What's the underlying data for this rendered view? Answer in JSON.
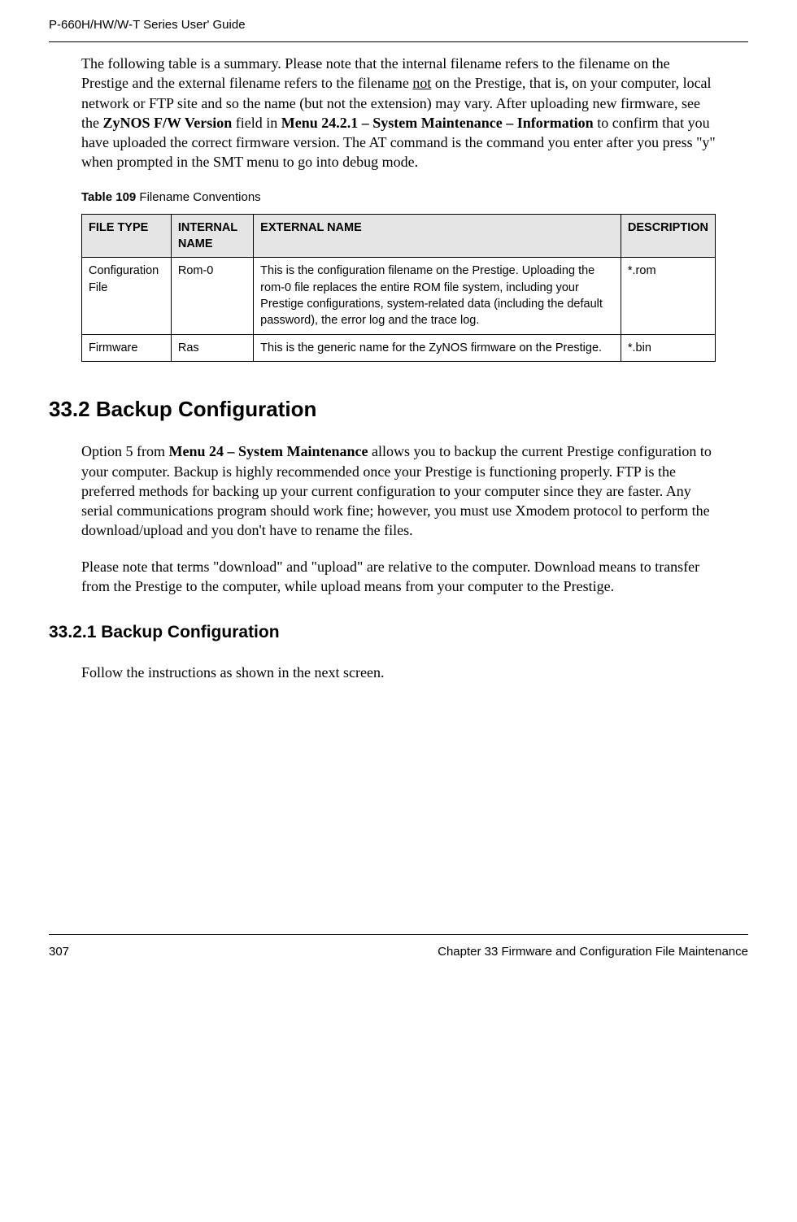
{
  "header": {
    "guide_title": "P-660H/HW/W-T Series User' Guide"
  },
  "intro": {
    "text_before_underline": "The following table is a summary. Please note that the internal filename refers to the filename on the Prestige and the external filename refers to the filename ",
    "underlined": "not",
    "text_after_underline": " on the Prestige, that is, on your computer, local network or FTP site and so the name (but not the extension) may vary. After uploading new firmware, see the ",
    "bold1": "ZyNOS F/W Version",
    "mid1": " field in ",
    "bold2": "Menu 24.2.1 – System Maintenance – Information",
    "tail": " to confirm that you have uploaded the correct firmware version. The AT command is the command you enter after you press \"y\" when prompted in the SMT menu to go into debug mode."
  },
  "table": {
    "caption_label": "Table 109",
    "caption_text": "   Filename Conventions",
    "headers": {
      "col1": "FILE TYPE",
      "col2": "INTERNAL NAME",
      "col3": "EXTERNAL NAME",
      "col4": "DESCRIPTION"
    },
    "rows": [
      {
        "file_type": "Configuration File",
        "internal_name": "Rom-0",
        "external_name": "This is the configuration filename on the Prestige. Uploading the rom-0 file replaces the entire ROM file system, including your Prestige configurations, system-related data (including the default password), the error log and the trace log.",
        "description": "*.rom"
      },
      {
        "file_type": "Firmware",
        "internal_name": "Ras",
        "external_name": "This is the generic name for the ZyNOS firmware on the Prestige.",
        "description": "*.bin"
      }
    ]
  },
  "section_33_2": {
    "heading": "33.2  Backup Configuration",
    "para1_before_bold": "Option 5 from ",
    "para1_bold": "Menu 24 – System Maintenance",
    "para1_after_bold": " allows you to backup the current Prestige configuration to your computer. Backup is highly recommended once your Prestige is functioning properly. FTP is the preferred methods for backing up your current configuration to your computer since they are faster. Any serial communications program should work fine; however, you must use Xmodem protocol to perform the download/upload and you don't have to rename the files.",
    "para2": "Please note that terms \"download\" and \"upload\" are relative to the computer. Download means to transfer from the Prestige to the computer, while upload means from your computer to the Prestige."
  },
  "section_33_2_1": {
    "heading": "33.2.1  Backup Configuration",
    "para": "Follow the instructions as shown in the next screen."
  },
  "footer": {
    "page": "307",
    "chapter": "Chapter 33 Firmware and Configuration File Maintenance"
  }
}
